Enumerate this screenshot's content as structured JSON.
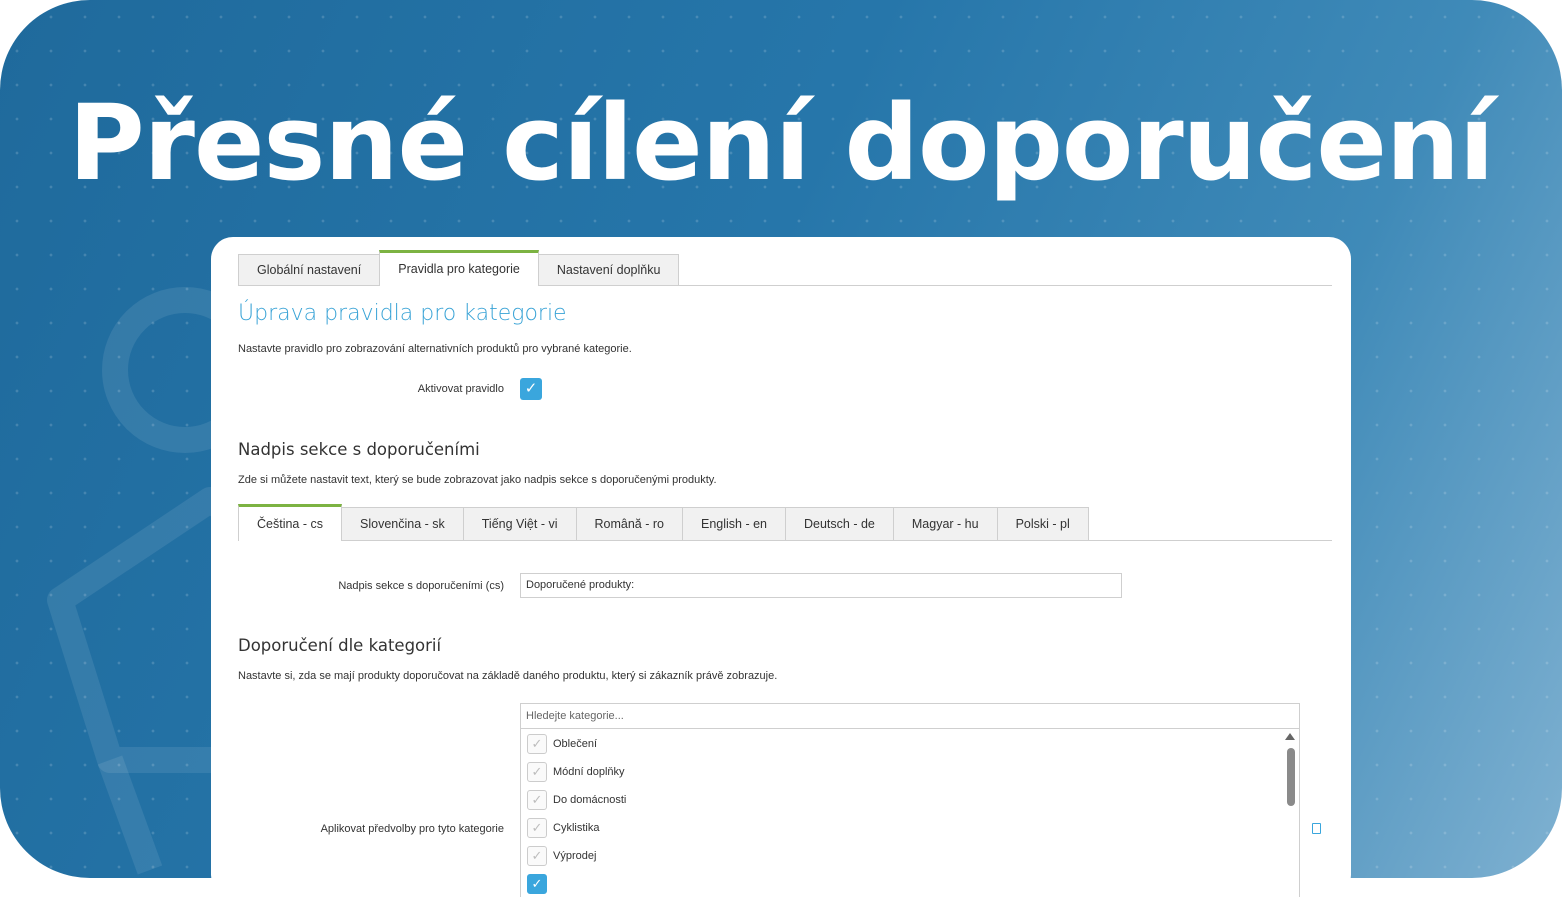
{
  "headline": "Přesné cílení doporučení",
  "main_tabs": [
    {
      "label": "Globální nastavení",
      "active": false
    },
    {
      "label": "Pravidla pro kategorie",
      "active": true
    },
    {
      "label": "Nastavení doplňku",
      "active": false
    }
  ],
  "page_title": "Úprava pravidla pro kategorie",
  "page_desc": "Nastavte pravidlo pro zobrazování alternativních produktů pro vybrané kategorie.",
  "activate": {
    "label": "Aktivovat pravidlo",
    "checked": true
  },
  "section_heading": {
    "title": "Nadpis sekce s doporučeními",
    "desc": "Zde si můžete nastavit text, který se bude zobrazovat jako nadpis sekce s doporučenými produkty."
  },
  "language_tabs": [
    {
      "label": "Čeština - cs",
      "active": true
    },
    {
      "label": "Slovenčina - sk",
      "active": false
    },
    {
      "label": "Tiếng Việt - vi",
      "active": false
    },
    {
      "label": "Română - ro",
      "active": false
    },
    {
      "label": "English - en",
      "active": false
    },
    {
      "label": "Deutsch - de",
      "active": false
    },
    {
      "label": "Magyar - hu",
      "active": false
    },
    {
      "label": "Polski - pl",
      "active": false
    }
  ],
  "heading_field": {
    "label": "Nadpis sekce s doporučeními (cs)",
    "value": "Doporučené produkty:"
  },
  "category_section": {
    "title": "Doporučení dle kategorií",
    "desc": "Nastavte si, zda se mají produkty doporučovat na základě daného produktu, který si zákazník právě zobrazuje."
  },
  "category_picker": {
    "label": "Aplikovat předvolby pro tyto kategorie",
    "search_placeholder": "Hledejte kategorie...",
    "items": [
      {
        "label": "Oblečení",
        "checked": false
      },
      {
        "label": "Módní doplňky",
        "checked": false
      },
      {
        "label": "Do domácnosti",
        "checked": false
      },
      {
        "label": "Cyklistika",
        "checked": false
      },
      {
        "label": "Výprodej",
        "checked": false
      },
      {
        "label": "",
        "checked": true
      }
    ]
  },
  "colors": {
    "accent": "#39a3d6",
    "tab_active": "#7cb342",
    "banner": "#2676aa"
  }
}
